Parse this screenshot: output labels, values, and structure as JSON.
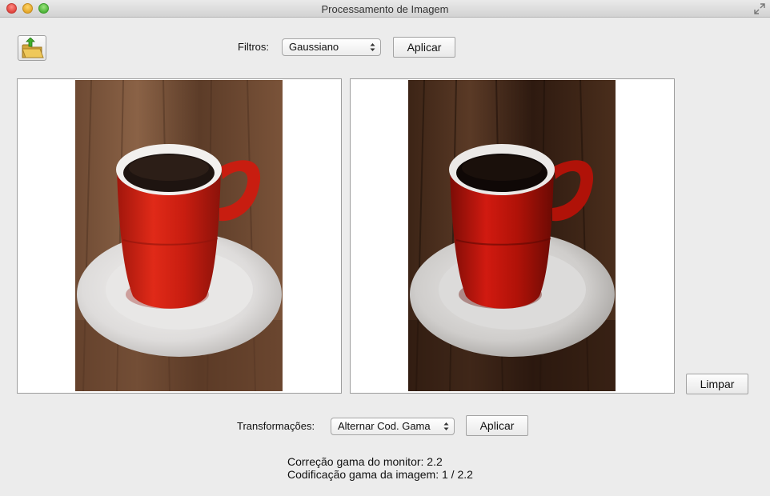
{
  "window": {
    "title": "Processamento de Imagem"
  },
  "toolbar": {
    "open_icon": "open-folder-icon",
    "filters_label": "Filtros:",
    "filters_selected": "Gaussiano",
    "apply_label": "Aplicar"
  },
  "panels": {
    "original": {
      "content": "red-coffee-cup-photo"
    },
    "processed": {
      "content": "red-coffee-cup-photo-processed"
    }
  },
  "clear_label": "Limpar",
  "transforms": {
    "label": "Transformações:",
    "selected": "Alternar Cod. Gama",
    "apply_label": "Aplicar"
  },
  "status": {
    "monitor_gamma": "Correção gama do monitor: 2.2",
    "image_gamma": "Codificação gama da imagem: 1 / 2.2"
  },
  "colors": {
    "cup_red": "#c8190f",
    "wood": "#5a3a26"
  }
}
